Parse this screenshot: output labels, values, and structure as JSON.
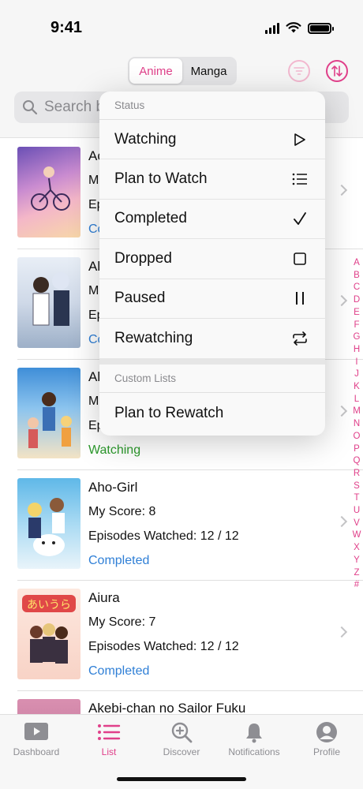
{
  "status_bar": {
    "time": "9:41"
  },
  "header": {
    "segments": [
      "Anime",
      "Manga"
    ],
    "active_segment": "Anime",
    "search_placeholder": "Search by title"
  },
  "menu": {
    "status_header": "Status",
    "items": [
      {
        "label": "Watching",
        "icon": "play-icon"
      },
      {
        "label": "Plan to Watch",
        "icon": "list-icon"
      },
      {
        "label": "Completed",
        "icon": "checkmark-icon"
      },
      {
        "label": "Dropped",
        "icon": "square-icon"
      },
      {
        "label": "Paused",
        "icon": "pause-icon"
      },
      {
        "label": "Rewatching",
        "icon": "repeat-icon"
      }
    ],
    "custom_header": "Custom Lists",
    "custom_items": [
      {
        "label": "Plan to Rewatch"
      }
    ]
  },
  "list": [
    {
      "title": "Ac",
      "score": "M",
      "eps": "Ep",
      "status": "Co"
    },
    {
      "title": "Al",
      "score": "M",
      "eps": "Ep",
      "status": "Co"
    },
    {
      "title": "Al",
      "score": "M",
      "eps": "Ep",
      "status": "Watching"
    },
    {
      "title": "Aho-Girl",
      "score": "My Score: 8",
      "eps": "Episodes Watched: 12 / 12",
      "status": "Completed"
    },
    {
      "title": "Aiura",
      "score": "My Score: 7",
      "eps": "Episodes Watched: 12 / 12",
      "status": "Completed"
    },
    {
      "title": "Akebi-chan no Sailor Fuku",
      "score": "",
      "eps": "",
      "status": ""
    }
  ],
  "index_letters": [
    "A",
    "B",
    "C",
    "D",
    "E",
    "F",
    "G",
    "H",
    "I",
    "J",
    "K",
    "L",
    "M",
    "N",
    "O",
    "P",
    "Q",
    "R",
    "S",
    "T",
    "U",
    "V",
    "W",
    "X",
    "Y",
    "Z",
    "#"
  ],
  "tabs": [
    {
      "label": "Dashboard",
      "icon": "dashboard-icon"
    },
    {
      "label": "List",
      "icon": "list-icon"
    },
    {
      "label": "Discover",
      "icon": "discover-icon"
    },
    {
      "label": "Notifications",
      "icon": "bell-icon"
    },
    {
      "label": "Profile",
      "icon": "profile-icon"
    }
  ],
  "colors": {
    "accent": "#e0408a",
    "completed": "#2f7fd6",
    "watching": "#2c9a2c"
  }
}
